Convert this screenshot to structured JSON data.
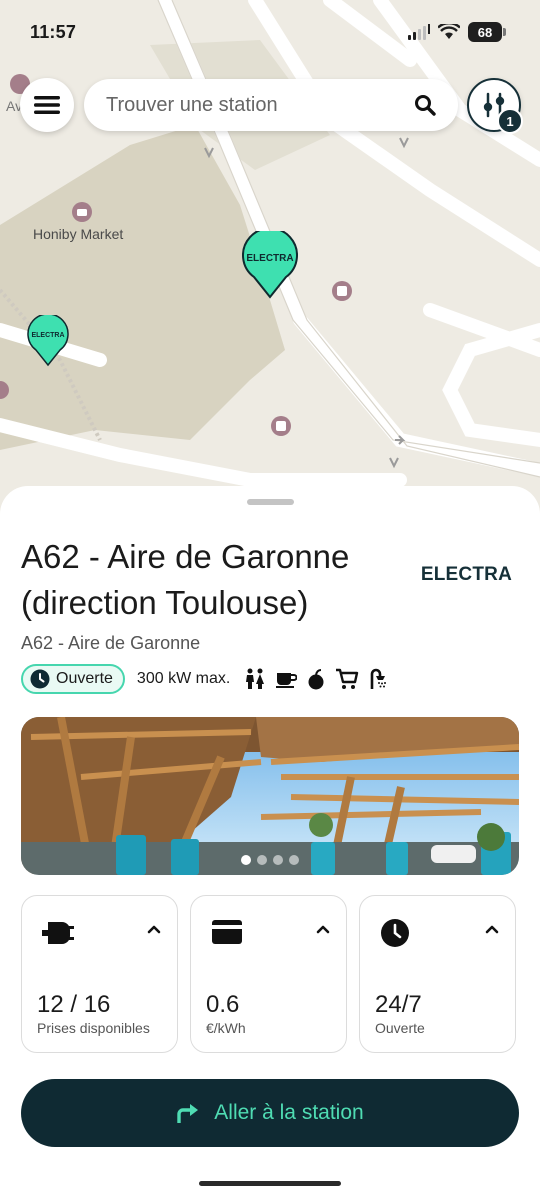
{
  "status": {
    "time": "11:57",
    "battery": "68"
  },
  "search": {
    "placeholder": "Trouver une station"
  },
  "filter": {
    "badge_count": "1"
  },
  "map": {
    "place_label": "Honiby Market",
    "edge_label": "Av",
    "pins": [
      {
        "label": "ELECTRA"
      },
      {
        "label": "ELECTRA"
      }
    ]
  },
  "station": {
    "title": "A62 - Aire de Garonne (direction Toulouse)",
    "brand": "ELECTRA",
    "subtitle": "A62 - Aire de Garonne",
    "status": "Ouverte",
    "max_power": "300 kW max.",
    "amenities": [
      "toilets-icon",
      "coffee-icon",
      "food-icon",
      "shopping-cart-icon",
      "shower-icon"
    ],
    "photo": {
      "pages": 4,
      "active_page": 1
    }
  },
  "cards": [
    {
      "icon": "plug-icon",
      "value": "12 / 16",
      "label": "Prises disponibles"
    },
    {
      "icon": "credit-card-icon",
      "value": "0.6",
      "label": "€/kWh"
    },
    {
      "icon": "clock-icon",
      "value": "24/7",
      "label": "Ouverte"
    }
  ],
  "cta": {
    "label": "Aller à la station"
  },
  "colors": {
    "accent": "#46d6ae",
    "dark": "#0f2a33",
    "pin": "#3ee0b0"
  }
}
